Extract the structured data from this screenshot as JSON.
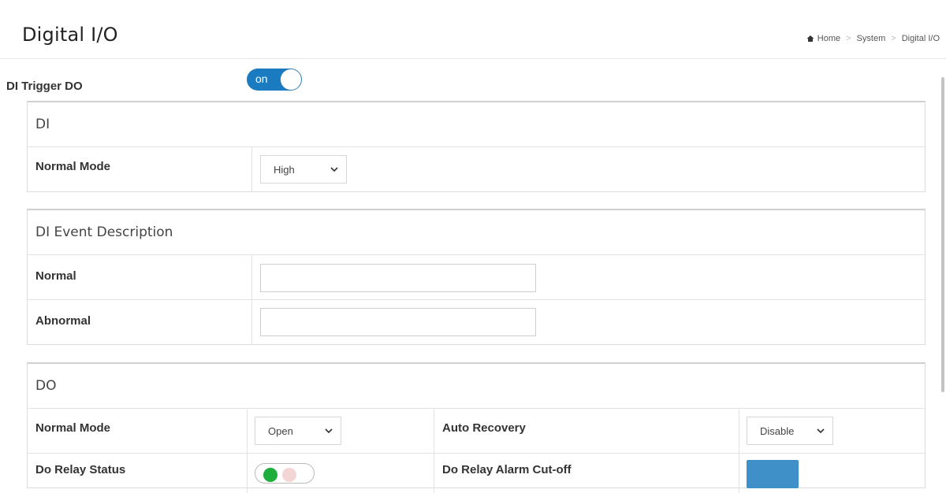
{
  "header": {
    "title": "Digital I/O",
    "breadcrumb": [
      "Home",
      "System",
      "Digital I/O"
    ]
  },
  "trigger": {
    "label": "DI Trigger DO",
    "toggle_text": "on",
    "state": "on"
  },
  "di": {
    "title": "DI",
    "normal_mode_label": "Normal Mode",
    "normal_mode_value": "High"
  },
  "di_event": {
    "title": "DI Event Description",
    "normal_label": "Normal",
    "normal_value": "",
    "abnormal_label": "Abnormal",
    "abnormal_value": ""
  },
  "do": {
    "title": "DO",
    "normal_mode_label": "Normal Mode",
    "normal_mode_value": "Open",
    "auto_recovery_label": "Auto Recovery",
    "auto_recovery_value": "Disable",
    "relay_status_label": "Do Relay Status",
    "relay_alarm_label": "Do Relay Alarm Cut-off"
  },
  "colors": {
    "accent": "#1a7bc1",
    "button": "#3f8fc8",
    "status_green": "#1fae3b"
  }
}
